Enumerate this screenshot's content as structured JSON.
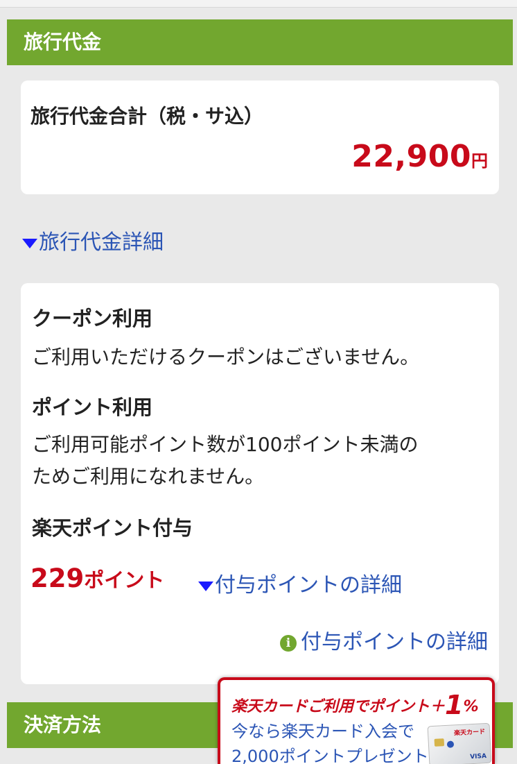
{
  "sections": {
    "travel_fee_header": "旅行代金",
    "payment_header": "決済方法"
  },
  "total": {
    "label": "旅行代金合計（税・サ込）",
    "amount": "22,900",
    "currency": "円"
  },
  "fee_detail_link": "旅行代金詳細",
  "coupon": {
    "title": "クーポン利用",
    "message": "ご利用いただけるクーポンはございません。"
  },
  "point_use": {
    "title": "ポイント利用",
    "message_line1": "ご利用可能ポイント数が100ポイント未満の",
    "message_line2": "ためご利用になれません。"
  },
  "point_grant": {
    "title": "楽天ポイント付与",
    "amount": "229",
    "unit": "ポイント",
    "detail_link": "付与ポイントの詳細",
    "info_link": "付与ポイントの詳細"
  },
  "promo": {
    "title_text": "楽天カードご利用でポイント＋",
    "title_number": "1",
    "title_percent": "%",
    "line1": "今なら楽天カード入会で",
    "line2": "2,000ポイントプレゼント",
    "card_logo": "楽天カード",
    "card_brand": "VISA"
  },
  "colors": {
    "header_green": "#72a72f",
    "price_red": "#c80a1a",
    "link_blue": "#2b55b5",
    "triangle_blue": "#1a1aff",
    "page_bg": "#e9e9e9"
  },
  "icons": {
    "toggle": "down-triangle-icon",
    "info": "info-circle-icon"
  }
}
